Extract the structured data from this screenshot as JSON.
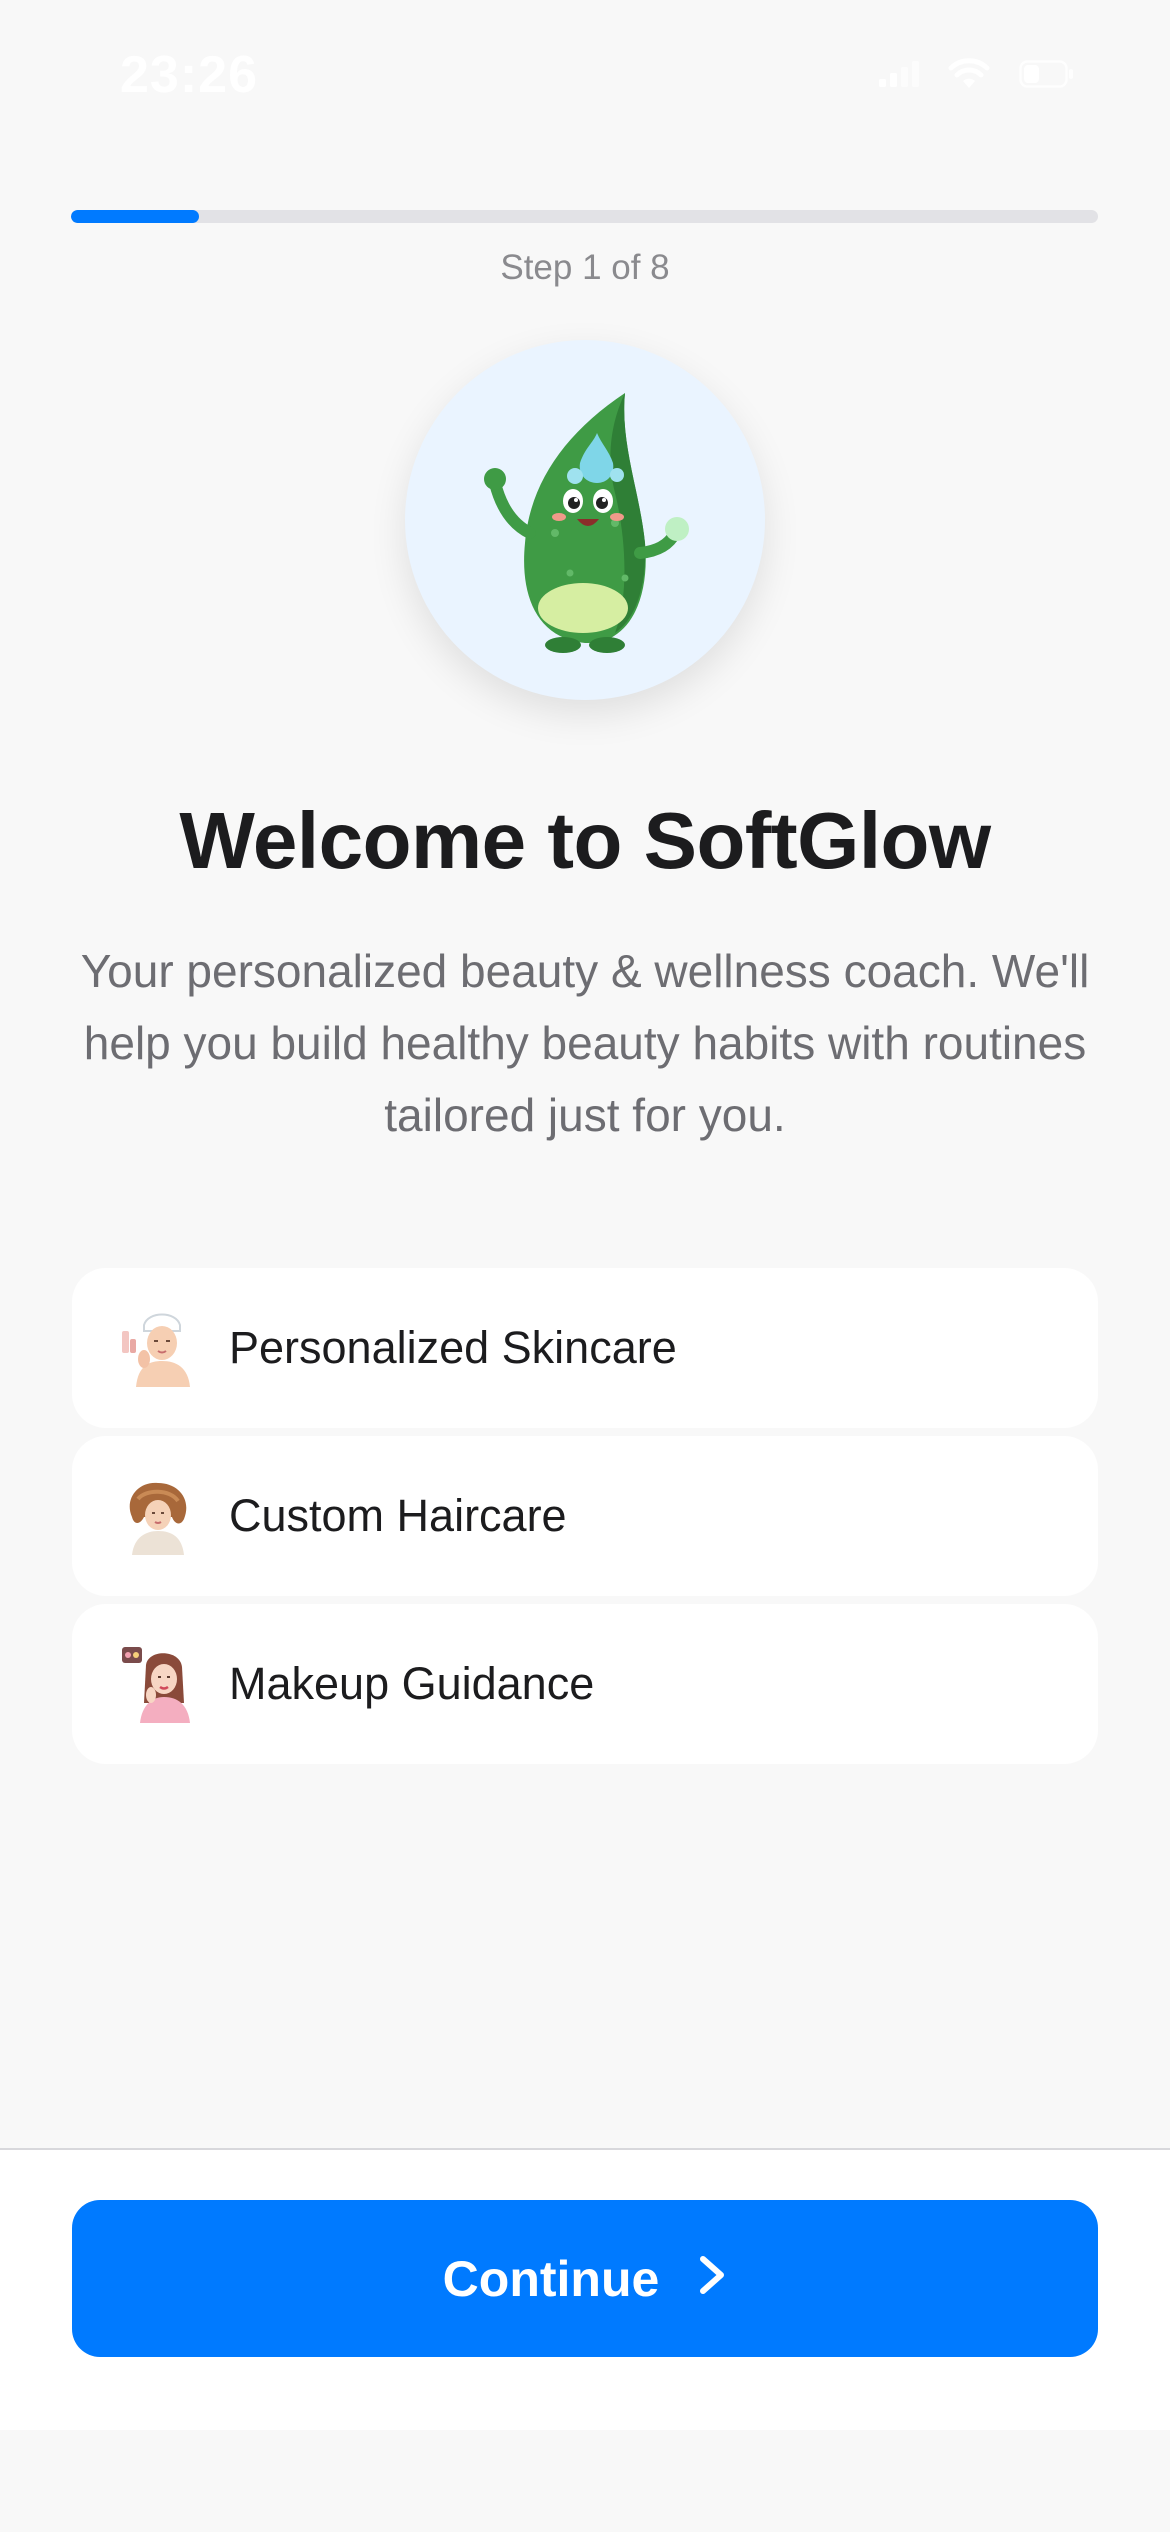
{
  "status_bar": {
    "time": "23:26",
    "icons": [
      "signal-icon",
      "wifi-icon",
      "battery-icon"
    ]
  },
  "progress": {
    "current_step": 1,
    "total_steps": 8,
    "fraction": 0.125,
    "label": "Step 1 of 8"
  },
  "hero": {
    "mascot": "aloe-vera-mascot-icon"
  },
  "welcome": {
    "title": "Welcome to SoftGlow",
    "subtitle": "Your personalized beauty & wellness coach. We'll help you build healthy beauty habits with routines tailored just for you."
  },
  "features": [
    {
      "label": "Personalized Skincare",
      "icon": "skincare-woman-icon"
    },
    {
      "label": "Custom Haircare",
      "icon": "haircare-woman-icon"
    },
    {
      "label": "Makeup Guidance",
      "icon": "makeup-woman-icon"
    }
  ],
  "footer": {
    "continue_label": "Continue",
    "continue_icon": "chevron-right-icon"
  },
  "colors": {
    "accent": "#007aff",
    "background": "#f8f8f8",
    "card": "#ffffff",
    "mascot_bg": "#eaf4ff"
  }
}
